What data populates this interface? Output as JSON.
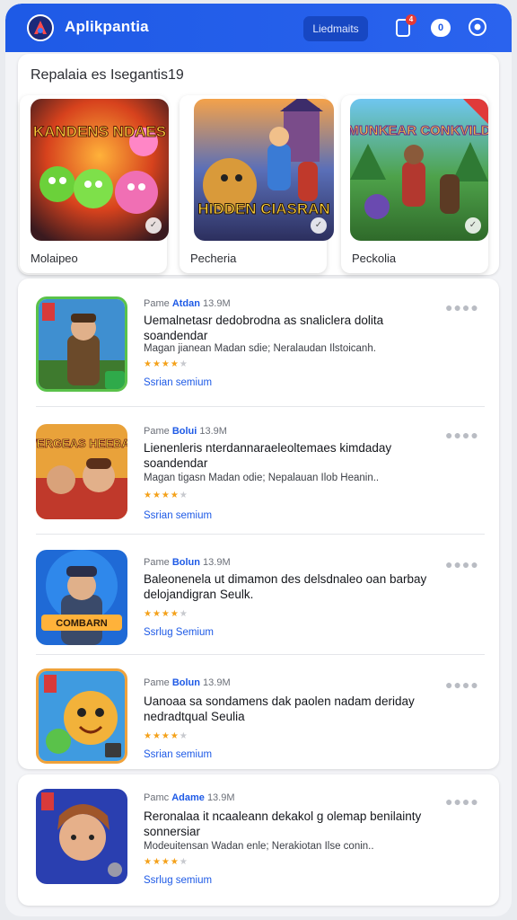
{
  "header": {
    "app_title": "Aplikpantia",
    "button_label": "Liedmaits",
    "notification_count": "4",
    "chip_text": "0"
  },
  "featured": {
    "title": "Repalaia es Isegantis19",
    "items": [
      {
        "label": "Molaipeo",
        "art_text": "KANDENS NDAES"
      },
      {
        "label": "Pecheria",
        "art_text": "HIDDEN CIASRAN"
      },
      {
        "label": "Peckolia",
        "art_text": "MUNKEAR CONKVILD"
      }
    ]
  },
  "list": {
    "rows": [
      {
        "meta_prefix": "Pame",
        "meta_accent": "Atdan",
        "meta_size": "13.9M",
        "name": "Uemalnetasr dedobrodna as snaliclera dolita soandendar",
        "desc": "Magan jianean Madan sdie; Neralaudan Ilstoicanh.",
        "stars": 4,
        "link": "Ssrian semium",
        "art_text": ""
      },
      {
        "meta_prefix": "Pame",
        "meta_accent": "Bolui",
        "meta_size": "13.9M",
        "name": "Lienenleris nterdannaraeleoltemaes kimdaday soandendar",
        "desc": "Magan tigasn Madan odie; Nepalauan Ilob Heanin..",
        "stars": 4,
        "link": "Ssrian semium",
        "art_text": "WERGEAS HEEBAE"
      },
      {
        "meta_prefix": "Pame",
        "meta_accent": "Bolun",
        "meta_size": "13.9M",
        "name": "Baleonenela ut dimamon des delsdnaleo oan barbay delojandigran Seulk.",
        "desc": "",
        "stars": 4,
        "link": "Ssrlug Semium",
        "art_text": "COMBARN"
      },
      {
        "meta_prefix": "Pame",
        "meta_accent": "Bolun",
        "meta_size": "13.9M",
        "name": "Uanoaa sa sondamens dak paolen nadam deriday nedradtqual Seulia",
        "desc": "",
        "stars": 4,
        "link": "Ssrian semium",
        "art_text": ""
      }
    ],
    "last_row": {
      "meta_prefix": "Pamc",
      "meta_accent": "Adame",
      "meta_size": "13.9M",
      "name": "Reronalaa it ncaaleann dekakol g olemap benilainty sonnersiar",
      "desc": "Modeuitensan Wadan enle; Nerakiotan Ilse conin..",
      "stars": 4,
      "link": "Ssrlug semium"
    }
  }
}
